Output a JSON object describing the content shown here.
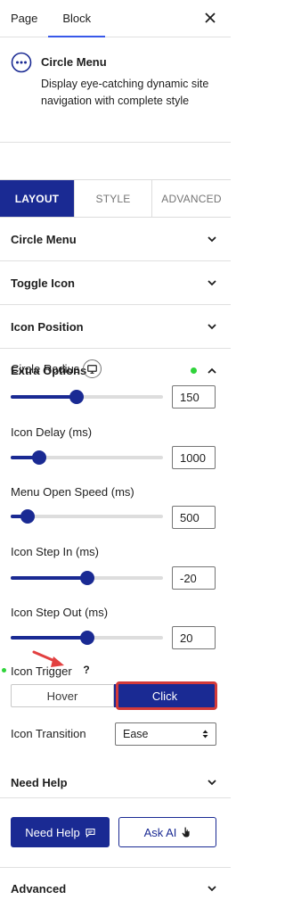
{
  "tabs": [
    {
      "label": "Page"
    },
    {
      "label": "Block"
    }
  ],
  "block": {
    "title": "Circle Menu",
    "description": "Display eye-catching dynamic site navigation with complete style"
  },
  "settings_tabs": [
    {
      "label": "LAYOUT",
      "active": true
    },
    {
      "label": "STYLE",
      "active": false
    },
    {
      "label": "ADVANCED",
      "active": false
    }
  ],
  "panels": {
    "circle_menu": "Circle Menu",
    "toggle_icon": "Toggle Icon",
    "icon_position": "Icon Position",
    "extra_options": "Extra Options",
    "need_help": "Need Help",
    "advanced": "Advanced"
  },
  "controls": {
    "circle_radius": {
      "label": "Circle Radius",
      "value": "150",
      "fraction": 0.43
    },
    "icon_delay": {
      "label": "Icon Delay (ms)",
      "value": "1000",
      "fraction": 0.19
    },
    "menu_open_speed": {
      "label": "Menu Open Speed (ms)",
      "value": "500",
      "fraction": 0.11
    },
    "icon_step_in": {
      "label": "Icon Step In (ms)",
      "value": "-20",
      "fraction": 0.5
    },
    "icon_step_out": {
      "label": "Icon Step Out (ms)",
      "value": "20",
      "fraction": 0.5
    },
    "icon_trigger": {
      "label": "Icon Trigger",
      "help": "?",
      "options": [
        "Hover",
        "Click"
      ],
      "selected": "Click"
    },
    "icon_transition": {
      "label": "Icon Transition",
      "value": "Ease"
    }
  },
  "buttons": {
    "need_help": "Need Help",
    "ask_ai": "Ask AI"
  },
  "colors": {
    "accent": "#1a2a93",
    "wp_blue": "#3858e9",
    "highlight_red": "#d33a3a",
    "status_green": "#2fd33a"
  }
}
